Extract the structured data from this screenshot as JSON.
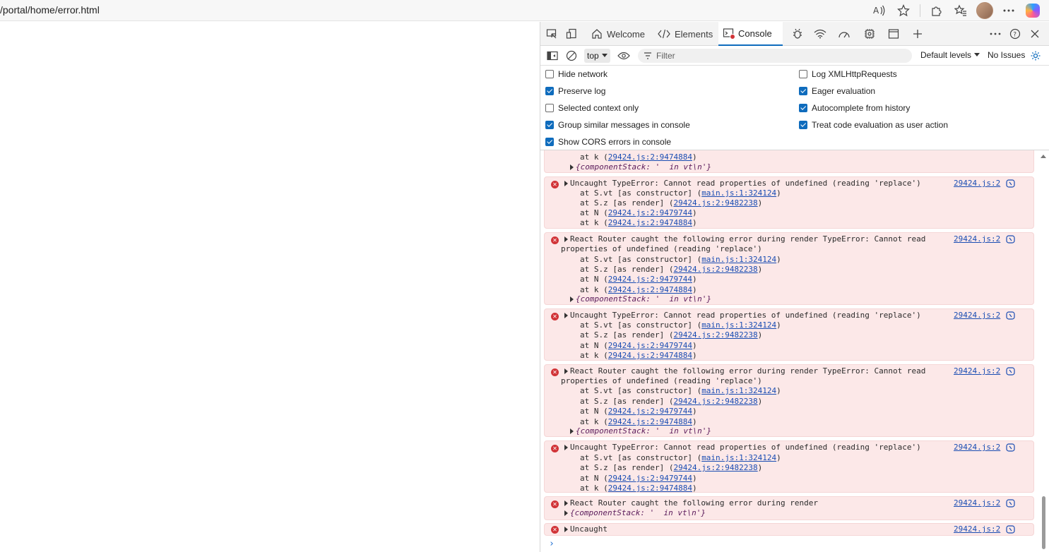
{
  "browser": {
    "url": "/portal/home/error.html"
  },
  "devtools": {
    "tabs": [
      {
        "label": "Welcome"
      },
      {
        "label": "Elements"
      },
      {
        "label": "Console"
      }
    ],
    "toolbar": {
      "context": "top",
      "filter_placeholder": "Filter",
      "levels": "Default levels",
      "issues": "No Issues"
    },
    "settings": {
      "left": [
        {
          "label": "Hide network",
          "checked": false
        },
        {
          "label": "Preserve log",
          "checked": true
        },
        {
          "label": "Selected context only",
          "checked": false
        },
        {
          "label": "Group similar messages in console",
          "checked": true
        },
        {
          "label": "Show CORS errors in console",
          "checked": true
        }
      ],
      "right": [
        {
          "label": "Log XMLHttpRequests",
          "checked": false
        },
        {
          "label": "Eager evaluation",
          "checked": true
        },
        {
          "label": "Autocomplete from history",
          "checked": true
        },
        {
          "label": "Treat code evaluation as user action",
          "checked": true
        }
      ]
    },
    "console": {
      "source": "29424.js:2",
      "partial": {
        "at_k": "at k (",
        "at_k_link": "29424.js:2:9474884",
        "stack": "{componentStack: '  in vt\\n'}"
      },
      "messages": [
        {
          "kind": "uncaught",
          "head": "Uncaught TypeError: Cannot read properties of undefined (reading 'replace')",
          "frames": [
            {
              "pre": "at S.vt [as constructor] (",
              "link": "main.js:1:324124"
            },
            {
              "pre": "at S.z [as render] (",
              "link": "29424.js:2:9482238"
            },
            {
              "pre": "at N (",
              "link": "29424.js:2:9479744"
            },
            {
              "pre": "at k (",
              "link": "29424.js:2:9474884"
            }
          ]
        },
        {
          "kind": "router",
          "head": "React Router caught the following error during render TypeError: Cannot read",
          "head2": "properties of undefined (reading 'replace')",
          "frames": [
            {
              "pre": "at S.vt [as constructor] (",
              "link": "main.js:1:324124"
            },
            {
              "pre": "at S.z [as render] (",
              "link": "29424.js:2:9482238"
            },
            {
              "pre": "at N (",
              "link": "29424.js:2:9479744"
            },
            {
              "pre": "at k (",
              "link": "29424.js:2:9474884"
            }
          ],
          "stack": "{componentStack: '  in vt\\n'}"
        },
        {
          "kind": "uncaught",
          "head": "Uncaught TypeError: Cannot read properties of undefined (reading 'replace')",
          "frames": [
            {
              "pre": "at S.vt [as constructor] (",
              "link": "main.js:1:324124"
            },
            {
              "pre": "at S.z [as render] (",
              "link": "29424.js:2:9482238"
            },
            {
              "pre": "at N (",
              "link": "29424.js:2:9479744"
            },
            {
              "pre": "at k (",
              "link": "29424.js:2:9474884"
            }
          ]
        },
        {
          "kind": "router",
          "head": "React Router caught the following error during render TypeError: Cannot read",
          "head2": "properties of undefined (reading 'replace')",
          "frames": [
            {
              "pre": "at S.vt [as constructor] (",
              "link": "main.js:1:324124"
            },
            {
              "pre": "at S.z [as render] (",
              "link": "29424.js:2:9482238"
            },
            {
              "pre": "at N (",
              "link": "29424.js:2:9479744"
            },
            {
              "pre": "at k (",
              "link": "29424.js:2:9474884"
            }
          ],
          "stack": "{componentStack: '  in vt\\n'}"
        },
        {
          "kind": "uncaught",
          "head": "Uncaught TypeError: Cannot read properties of undefined (reading 'replace')",
          "frames": [
            {
              "pre": "at S.vt [as constructor] (",
              "link": "main.js:1:324124"
            },
            {
              "pre": "at S.z [as render] (",
              "link": "29424.js:2:9482238"
            },
            {
              "pre": "at N (",
              "link": "29424.js:2:9479744"
            },
            {
              "pre": "at k (",
              "link": "29424.js:2:9474884"
            }
          ]
        },
        {
          "kind": "router-short",
          "head": "React Router caught the following error during render",
          "stack": "{componentStack: '  in vt\\n'}"
        },
        {
          "kind": "short",
          "head": "Uncaught"
        }
      ]
    }
  }
}
